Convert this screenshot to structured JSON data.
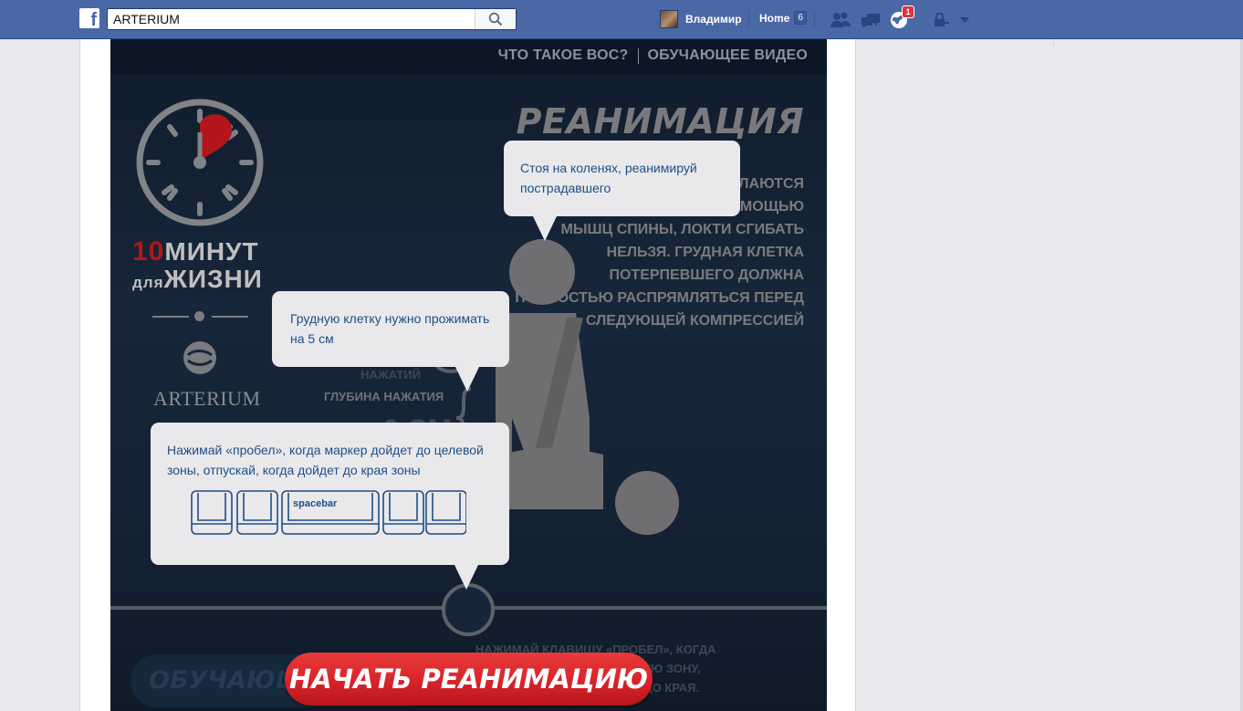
{
  "topbar": {
    "search_value": "ARTERIUM",
    "user_name": "Владимир",
    "home_label": "Home",
    "home_count": "6",
    "notifications_count": "1"
  },
  "app": {
    "nav": {
      "link1": "ЧТО ТАКОЕ ВОС?",
      "link2": "ОБУЧАЮЩЕЕ ВИДЕО"
    },
    "title": "РЕАНИМАЦИЯ",
    "instructions": "РИТМИЧНЫЕ НАЖАТИЯ ДЕЛАЮТСЯ ПРЯМЫМИ РУКАМИ С ПОМОЩЬЮ МЫШЦ СПИНЫ, ЛОКТИ СГИБАТЬ НЕЛЬЗЯ. ГРУДНАЯ КЛЕТКА ПОТЕРПЕВШЕГО ДОЛЖНА ПОЛНОСТЬЮ РАСПРЯМЛЯТЬСЯ ПЕРЕД СЛЕДУЮЩЕЙ КОМПРЕССИЕЙ",
    "logo": {
      "number": "10",
      "word1": "МИНУТ",
      "word2_small": "для",
      "word2": "ЖИЗНИ"
    },
    "brand": "ARTERIUM",
    "depth_label": "ГЛУБИНА НАЖАТИЯ",
    "depth_value": "6 СМ",
    "freq_text": "СИЛЫ И ЧАСТОТЫ НАЖАТИЙ",
    "press_hint": "НАЖИМАЙ КЛАВИШУ «ПРОБЕЛ», КОГДА МАРКЕР ДОЙДЕТ ДО ЦЕЛЕВУЮ ЗОНУ, ОТПУСКАЙ, КОГДА ДОЙДЕТ ДО КРАЯ.",
    "train_button": "ОБУЧАЮЩ",
    "start_button": "НАЧАТЬ РЕАНИМАЦИЮ"
  },
  "tooltips": {
    "tip1": "Стоя на коленях, реанимируй пострадавшего",
    "tip2": "Грудную клетку нужно прожимать на 5 см",
    "tip3": "Нажимай «пробел», когда маркер дойдет до целевой зоны, отпускай, когда дойдет до края зоны",
    "spacebar": "spacebar"
  },
  "colors": {
    "facebook_blue": "#4a67a6",
    "start_red": "#d8232a",
    "tooltip_text": "#1e4e86",
    "heart_red": "#b3161a"
  }
}
